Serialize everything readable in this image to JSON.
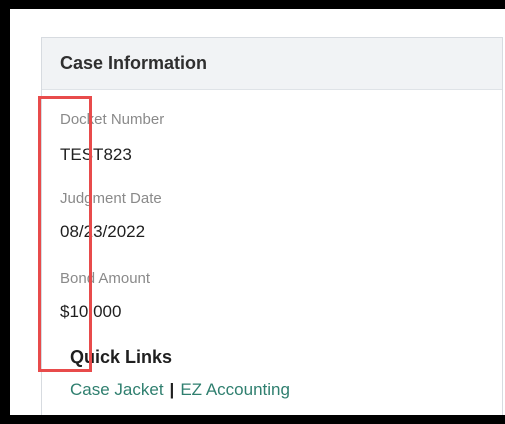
{
  "panel": {
    "title": "Case Information"
  },
  "fields": {
    "docket_label": "Docket Number",
    "docket_value": "TEST823",
    "judgment_label": "Judgment Date",
    "judgment_value": "08/23/2022",
    "bond_label": "Bond Amount",
    "bond_value": "$10,000"
  },
  "quick_links": {
    "title": "Quick Links",
    "case_jacket": "Case Jacket",
    "separator": "|",
    "ez_accounting": "EZ Accounting"
  },
  "colors": {
    "link": "#2f7f6f",
    "highlight": "#e84b4b",
    "header_bg": "#f1f3f5"
  }
}
